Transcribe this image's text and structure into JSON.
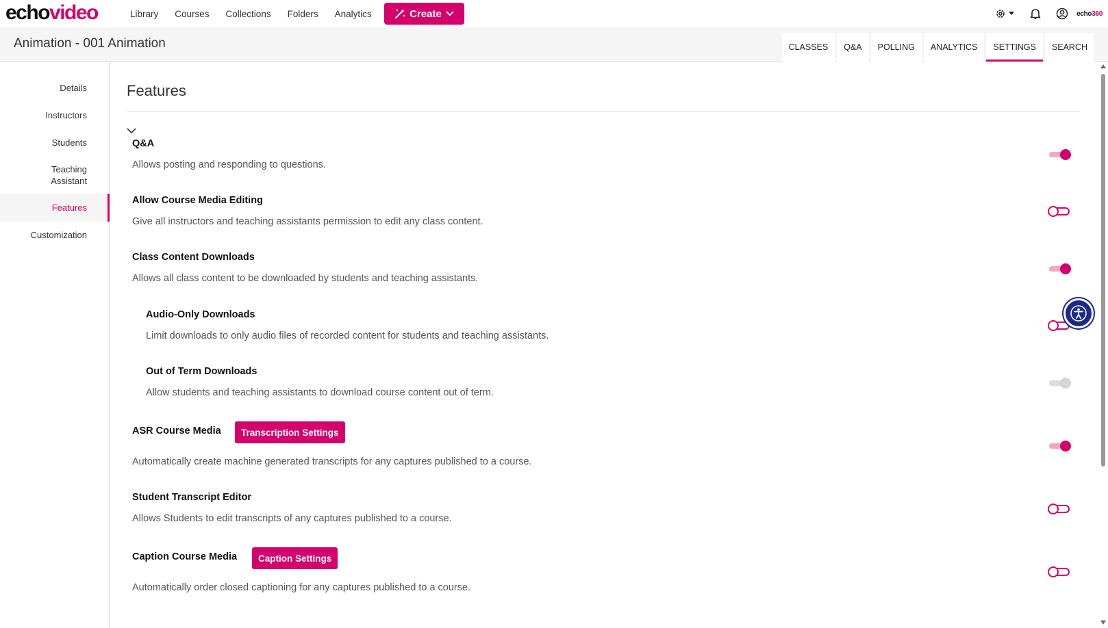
{
  "brand": {
    "part1": "echo",
    "part2": "video",
    "small_part1": "echo",
    "small_part2": "360"
  },
  "nav": {
    "links": [
      "Library",
      "Courses",
      "Collections",
      "Folders",
      "Analytics"
    ],
    "create_label": "Create"
  },
  "course": {
    "title": "Animation - 001 Animation"
  },
  "tabs": [
    {
      "label": "CLASSES",
      "active": false
    },
    {
      "label": "Q&A",
      "active": false
    },
    {
      "label": "POLLING",
      "active": false
    },
    {
      "label": "ANALYTICS",
      "active": false
    },
    {
      "label": "SETTINGS",
      "active": true
    },
    {
      "label": "SEARCH",
      "active": false
    }
  ],
  "sidebar": {
    "items": [
      {
        "label": "Details"
      },
      {
        "label": "Instructors"
      },
      {
        "label": "Students"
      },
      {
        "label": "Teaching Assistant"
      },
      {
        "label": "Features",
        "active": true
      },
      {
        "label": "Customization"
      }
    ]
  },
  "main": {
    "heading": "Features",
    "features": [
      {
        "title": "Q&A",
        "description": "Allows posting and responding to questions.",
        "enabled": true
      },
      {
        "title": "Allow Course Media Editing",
        "description": "Give all instructors and teaching assistants permission to edit any class content.",
        "enabled": false
      },
      {
        "title": "Class Content Downloads",
        "description": "Allows all class content to be downloaded by students and teaching assistants.",
        "enabled": true
      },
      {
        "title": "Audio-Only Downloads",
        "description": "Limit downloads to only audio files of recorded content for students and teaching assistants.",
        "enabled": false
      },
      {
        "title": "Out of Term Downloads",
        "description": "Allow students and teaching assistants to download course content out of term.",
        "enabled": false,
        "disabled": true
      },
      {
        "title": "ASR Course Media",
        "description": "Automatically create machine generated transcripts for any captures published to a course.",
        "enabled": true,
        "button": "Transcription Settings"
      },
      {
        "title": "Student Transcript Editor",
        "description": "Allows Students to edit transcripts of any captures published to a course.",
        "enabled": false
      },
      {
        "title": "Caption Course Media",
        "description": "Automatically order closed captioning for any captures published to a course.",
        "enabled": false,
        "button": "Caption Settings"
      }
    ]
  },
  "colors": {
    "accent": "#d4006b",
    "a11y": "#1b2a8a"
  },
  "icons": [
    "wand-icon",
    "chevron-down-icon",
    "gear-icon",
    "bell-icon",
    "user-circle-icon",
    "accessibility-icon"
  ]
}
